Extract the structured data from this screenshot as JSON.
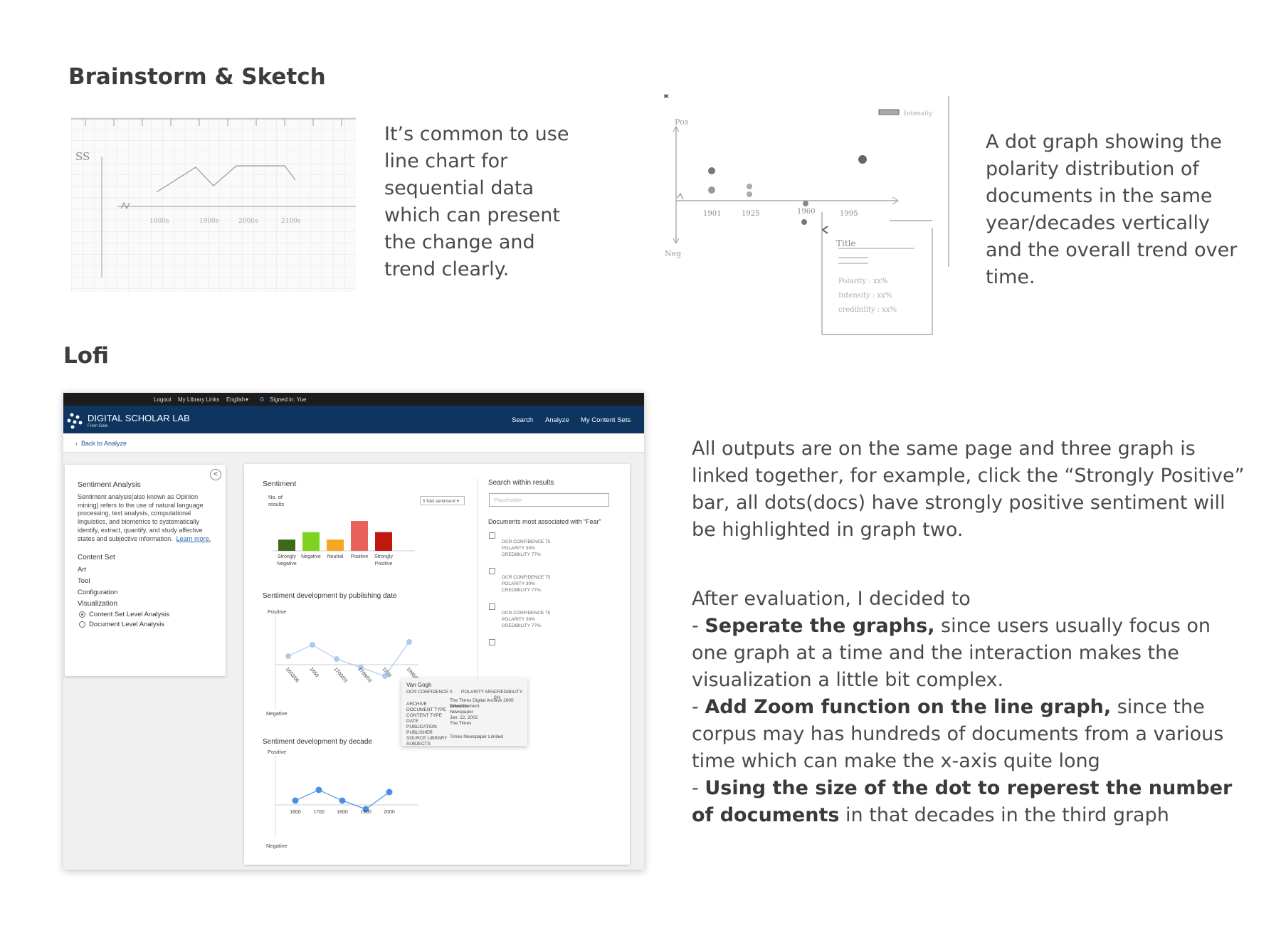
{
  "headings": {
    "brainstorm": "Brainstorm & Sketch",
    "lofi": "Lofi"
  },
  "sketch1_desc": "It’s common to use line chart for sequential data which can present the change and trend clearly.",
  "sketch2_desc": "A dot graph showing the polarity distribution of documents in the same year/decades vertically and the overall trend over time.",
  "sketch1": {
    "y_label": "SS",
    "x_labels": [
      "1800s",
      "1900s",
      "2000s",
      "2100s"
    ]
  },
  "sketch2": {
    "y_pos": "Pos",
    "y_neg": "Neg",
    "legend": "Intensity",
    "x_labels": [
      "1901",
      "1925",
      "1960",
      "1995"
    ],
    "card_title": "Title",
    "card_lines": [
      "Polarity : xx%",
      "Intensity : xx%",
      "credibility : xx%"
    ]
  },
  "linked_desc": "All outputs are on the same page and three graph is linked together, for example, click the “Strongly Positive” bar, all dots(docs) have strongly positive sentiment will be highlighted in graph two.",
  "evaluation": {
    "intro": "After evaluation,  I decided to",
    "points": [
      {
        "bold": "Seperate the graphs,",
        "rest": " since users usually focus on one graph at a time and the interaction makes the visualization a little bit complex."
      },
      {
        "bold": "Add Zoom function on the line graph,",
        "rest": " since the corpus may has hundreds of documents from a various time which can make the x-axis quite long"
      },
      {
        "bold": "Using the size of the dot to reperest the number of documents",
        "rest": " in that decades in the third graph"
      }
    ]
  },
  "lofi": {
    "topbar": {
      "logout": "Logout",
      "library_links": "My Library Links",
      "language": "English",
      "signed_in": "Signed in: Yue"
    },
    "brand": "DIGITAL SCHOLAR LAB",
    "brand_sub": "From Gale",
    "nav": [
      "Search",
      "Analyze",
      "My Content Sets"
    ],
    "back": "Back to Analyze",
    "left": {
      "title": "Sentiment Analysis",
      "description": "Sentiment analysis(also known as Opinion mining) refers to the use of natural language processing, text analysis, computational linguistics, and biometrics to systematically identify, extract, quantify, and study affective states and subjective information.",
      "learn_more": "Learn more.",
      "items": [
        "Content Set",
        "Art",
        "Tool",
        "Configuration",
        "Visualization"
      ],
      "radios": [
        "Content Set Level Analysis",
        "Document Level Analysis"
      ]
    },
    "sentiment": {
      "title": "Sentiment",
      "ylabel": "No. of results",
      "select": "5 fold sentiment"
    },
    "search": {
      "title": "Search within results",
      "placeholder": "Placeholder",
      "docs_title": "Documents most associated with “Fear”",
      "doc_meta": [
        "OCR CONFIDENCE  75",
        "POLARITY  30%",
        "CREDIBILITY 77%"
      ]
    },
    "dev_date": {
      "title": "Sentiment development by publishing date",
      "positive": "Positive",
      "negative": "Negative"
    },
    "dev_decade": {
      "title": "Sentiment development by decade",
      "positive": "Positive",
      "negative": "Negative"
    },
    "tooltip": {
      "title": "Van Gogh",
      "ocr": "OCR CONFIDENCE  0",
      "polarity": "POLARITY  55%",
      "credibility": "CREDIBILITY  0%",
      "fields": [
        "ARCHIVE",
        "DOCUMENT TYPE",
        "CONTENT TYPE",
        "DATE",
        "PUBLICATION",
        "PUBLISHER",
        "SOURCE LIBRARY",
        "SUBJECTS"
      ],
      "values": [
        "The Times Digital Archive 2005 Onwards",
        "Advertisement",
        "Newspaper",
        "Jan. 12, 2002",
        "The Times",
        "",
        "Times Newspaper Limited",
        ""
      ]
    }
  },
  "chart_data": [
    {
      "type": "bar",
      "title": "Sentiment",
      "ylabel": "No. of results",
      "categories": [
        "Strongly Negative",
        "Negative",
        "Neutral",
        "Positive",
        "Strongly Positive"
      ],
      "values": [
        3,
        5,
        3,
        8,
        5
      ],
      "colors": [
        "#3d6a1a",
        "#7ed321",
        "#f5a623",
        "#e8625a",
        "#c0170f"
      ]
    },
    {
      "type": "line",
      "title": "Sentiment development by publishing date",
      "ylabel_top": "Positive",
      "ylabel_bottom": "Negative",
      "x": [
        "1603/06",
        "1650",
        "1700/03",
        "1788/03",
        "1938",
        "1995/05"
      ],
      "values": [
        0.3,
        0.7,
        0.2,
        -0.1,
        -0.4,
        0.8
      ]
    },
    {
      "type": "line",
      "title": "Sentiment development by decade",
      "ylabel_top": "Positive",
      "ylabel_bottom": "Negative",
      "x": [
        "1600",
        "1700",
        "1800",
        "1900",
        "2000"
      ],
      "values": [
        0.2,
        0.7,
        0.2,
        -0.2,
        0.6
      ]
    }
  ]
}
